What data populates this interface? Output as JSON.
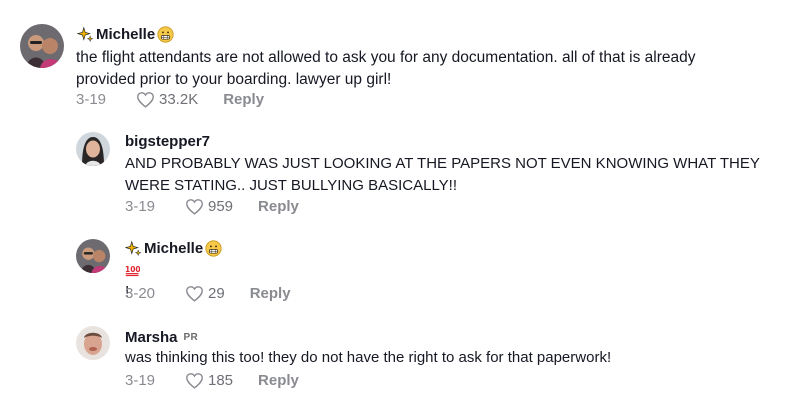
{
  "comments": [
    {
      "username": "Michelle",
      "text": "the flight attendants are not allowed to ask you for any documentation. all of that is already provided prior to your boarding. lawyer up girl!",
      "date": "3-19",
      "likes": "33.2K",
      "reply_label": "Reply",
      "avatar_colors": [
        "#7b5a4a",
        "#c0446e"
      ]
    },
    {
      "username": "bigstepper7",
      "text": "AND PROBABLY WAS JUST LOOKING AT THE PAPERS NOT EVEN KNOWING WHAT THEY WERE STATING.. JUST BULLYING BASICALLY!!",
      "date": "3-19",
      "likes": "959",
      "reply_label": "Reply"
    },
    {
      "username": "Michelle",
      "text": "!",
      "date": "3-20",
      "likes": "29",
      "reply_label": "Reply"
    },
    {
      "username": "Marsha",
      "badge": "PR",
      "text": "was thinking this too! they do not have the right to ask for that paperwork!",
      "date": "3-19",
      "likes": "185",
      "reply_label": "Reply"
    }
  ],
  "colors": {
    "text": "#161823",
    "meta": "#8a8b91"
  }
}
